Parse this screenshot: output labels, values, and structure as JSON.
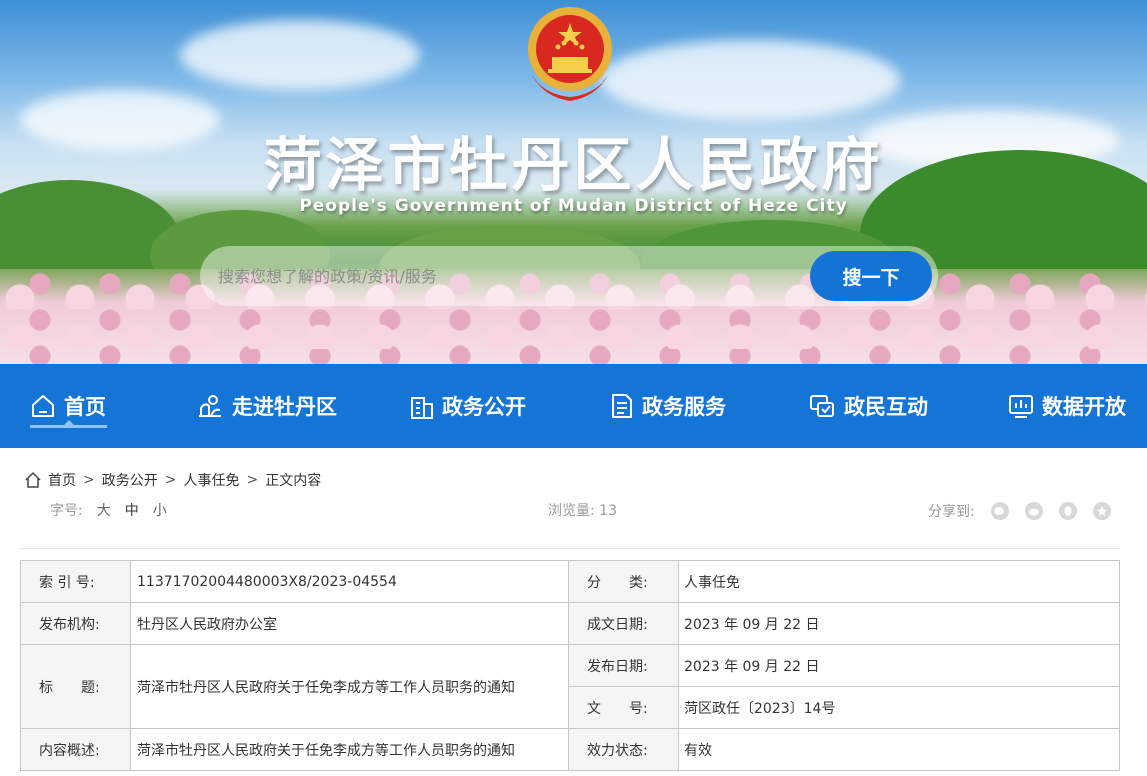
{
  "header": {
    "title": "菏泽市牡丹区人民政府",
    "subtitle": "People's Government of Mudan District of Heze City",
    "search": {
      "placeholder": "搜索您想了解的政策/资讯/服务",
      "button_label": "搜一下"
    },
    "colors": {
      "accent": "#1474d6",
      "nav_bg": "#1475d6"
    }
  },
  "nav": {
    "items": [
      {
        "label": "首页",
        "icon": "home-icon"
      },
      {
        "label": "走进牡丹区",
        "icon": "landscape-icon"
      },
      {
        "label": "政务公开",
        "icon": "building-icon"
      },
      {
        "label": "政务服务",
        "icon": "document-icon"
      },
      {
        "label": "政民互动",
        "icon": "chat-icon"
      },
      {
        "label": "数据开放",
        "icon": "chart-icon"
      }
    ]
  },
  "breadcrumb": {
    "items": [
      "首页",
      "政务公开",
      "人事任免",
      "正文内容"
    ],
    "separator": ">"
  },
  "toolbar": {
    "font_label": "字号:",
    "font_options": [
      "大",
      "中",
      "小"
    ],
    "views_label": "浏览量:",
    "views_count": "13",
    "share_label": "分享到:",
    "share_icons": [
      "wechat-icon",
      "weibo-icon",
      "qq-icon",
      "qzone-icon"
    ]
  },
  "info": {
    "index_label": "索 引 号:",
    "index_value": "11371702004480003X8/2023-04554",
    "category_label": "分　　类:",
    "category_value": "人事任免",
    "org_label": "发布机构:",
    "org_value": "牡丹区人民政府办公室",
    "created_label": "成文日期:",
    "created_value": "2023 年 09 月 22 日",
    "title_label": "标　　题:",
    "title_value": "菏泽市牡丹区人民政府关于任免李成方等工作人员职务的通知",
    "published_label": "发布日期:",
    "published_value": "2023 年 09 月 22 日",
    "docno_label": "文　　号:",
    "docno_value": "菏区政任〔2023〕14号",
    "summary_label": "内容概述:",
    "summary_value": "菏泽市牡丹区人民政府关于任免李成方等工作人员职务的通知",
    "status_label": "效力状态:",
    "status_value": "有效"
  }
}
